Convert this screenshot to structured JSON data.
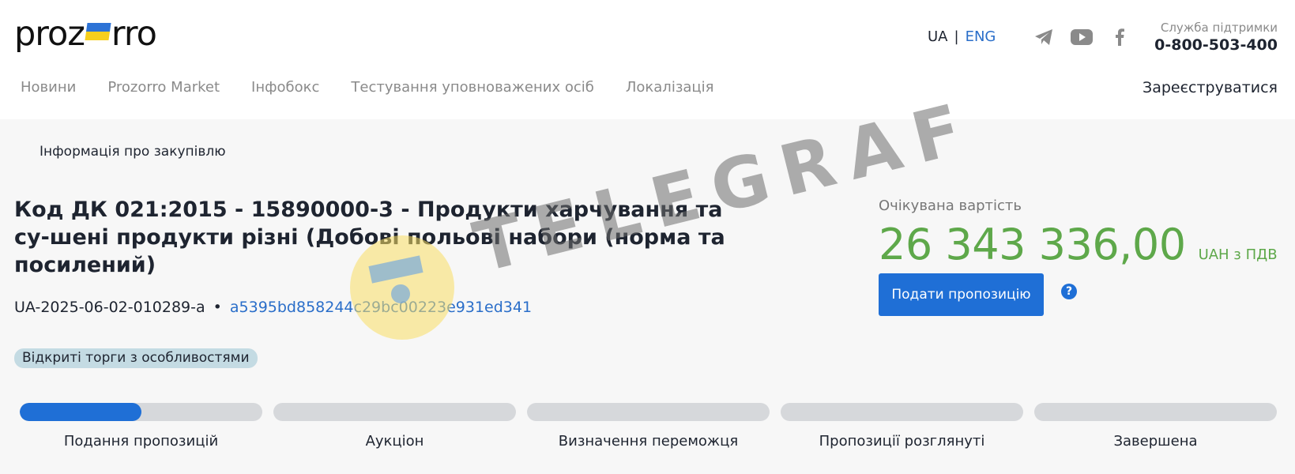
{
  "header": {
    "logo_left": "proz",
    "logo_right": "rro",
    "lang_ua": "UA",
    "lang_sep": "|",
    "lang_eng": "ENG",
    "support_label": "Служба підтримки",
    "support_phone": "0-800-503-400",
    "nav": [
      "Новини",
      "Prozorro Market",
      "Інфобокс",
      "Тестування уповноважених осіб",
      "Локалізація"
    ],
    "register": "Зареєструватися"
  },
  "tender": {
    "breadcrumb": "Інформація про закупівлю",
    "title": "Код ДК 021:2015 - 15890000-3 - Продукти харчування та су-шені продукти різні (Добові польові набори (норма та посилений)",
    "id": "UA-2025-06-02-010289-a",
    "separator": "•",
    "hash": "a5395bd858244c29bc00223e931ed341",
    "procedure_type": "Відкриті торги з особливостями",
    "expected_value_label": "Очікувана вартість",
    "expected_value": "26 343 336,00",
    "currency": "UAH з ПДВ",
    "submit_button": "Подати пропозицію",
    "help": "?"
  },
  "stages": [
    {
      "label": "Подання пропозицій",
      "progress": 0.5
    },
    {
      "label": "Аукціон",
      "progress": 0
    },
    {
      "label": "Визначення переможця",
      "progress": 0
    },
    {
      "label": "Пропозиції розглянуті",
      "progress": 0
    },
    {
      "label": "Завершена",
      "progress": 0
    }
  ],
  "watermark": {
    "text": "TELEGRAF"
  },
  "colors": {
    "accent": "#1f6fd6",
    "value_green": "#5ea84a",
    "badge_bg": "#c4dbe3"
  },
  "icons": [
    "telegram-icon",
    "youtube-icon",
    "facebook-icon",
    "question-icon"
  ]
}
